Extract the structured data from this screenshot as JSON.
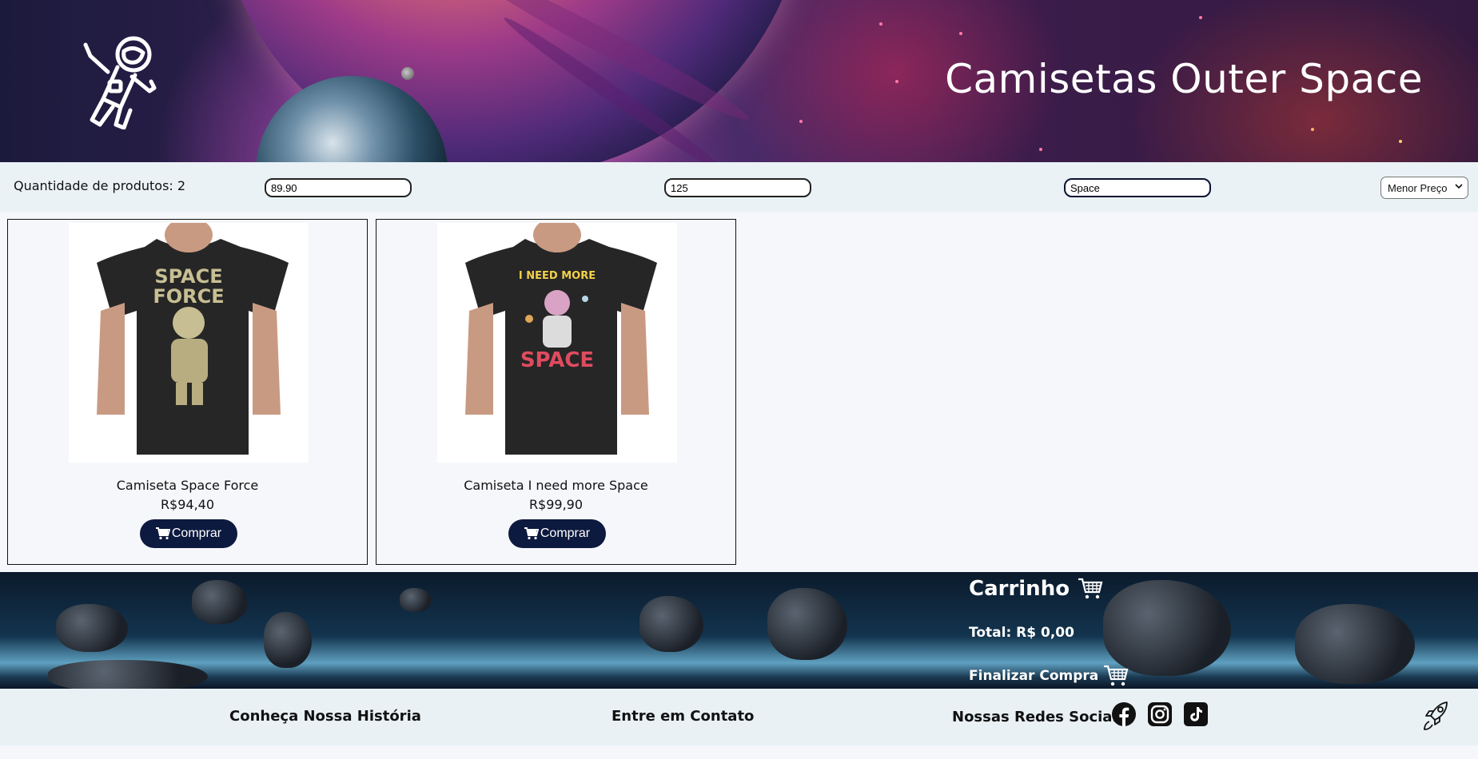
{
  "header": {
    "title": "Camisetas Outer Space",
    "logo_icon": "astronaut-icon"
  },
  "filters": {
    "quantity_label": "Quantidade de produtos: ",
    "quantity_value": "2",
    "min_price_value": "89.90",
    "max_price_value": "125",
    "search_value": "Space",
    "sort_selected": "Menor Preço",
    "sort_icon": "chevron-down-icon"
  },
  "products": [
    {
      "name": "Camiseta Space Force",
      "price": "R$94,40",
      "buy_label": "Comprar",
      "print_line1": "SPACE",
      "print_line2": "FORCE"
    },
    {
      "name": "Camiseta I need more Space",
      "price": "R$99,90",
      "buy_label": "Comprar",
      "print_line1": "I NEED MORE",
      "print_line2": "SPACE"
    }
  ],
  "cart": {
    "title": "Carrinho",
    "total_label": "Total: ",
    "total_value": "R$ 0,00",
    "checkout_label": "Finalizar Compra",
    "icon": "cart-icon"
  },
  "footer": {
    "history_link": "Conheça Nossa História",
    "contact_link": "Entre em Contato",
    "social_label": "Nossas Redes Sociais",
    "social_icons": [
      "facebook-icon",
      "instagram-icon",
      "tiktok-icon"
    ],
    "rocket_icon": "rocket-icon"
  },
  "colors": {
    "button_bg": "#0d1a3f",
    "filter_bar_bg": "#eaf2f6",
    "footer_bg": "#e9f1f5",
    "page_bg": "#f5f7fb"
  }
}
